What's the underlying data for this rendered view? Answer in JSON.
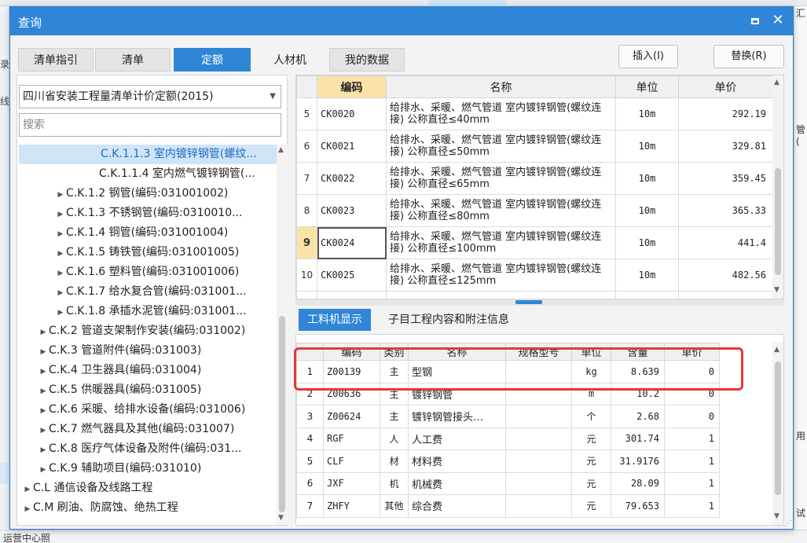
{
  "background": {
    "left_fragments": [
      "录",
      "线"
    ],
    "right_fragments": [
      "汇",
      "管(",
      "用",
      "试"
    ],
    "bottom_fragment": "运营中心照"
  },
  "dialog": {
    "title": "查询",
    "icons": [
      "maximize-icon",
      "close-icon"
    ]
  },
  "tabs": [
    {
      "label": "清单指引",
      "active": false
    },
    {
      "label": "清单",
      "active": false
    },
    {
      "label": "定额",
      "active": true
    },
    {
      "label": "人材机",
      "active": false
    },
    {
      "label": "我的数据",
      "active": false
    }
  ],
  "actions": {
    "insert": "插入(I)",
    "replace": "替换(R)"
  },
  "left": {
    "library": "四川省安装工程量清单计价定额(2015)",
    "search_placeholder": "搜索",
    "tree": [
      {
        "label": "C.K.1.1.3 室内镀锌钢管(螺纹...",
        "level": 3,
        "caret": false,
        "selected": true
      },
      {
        "label": "C.K.1.1.4 室内燃气镀锌钢管(...",
        "level": 3,
        "caret": false,
        "selected": false
      },
      {
        "label": "C.K.1.2 钢管(编码:031001002)",
        "level": 2,
        "caret": true,
        "selected": false
      },
      {
        "label": "C.K.1.3 不锈钢管(编码:0310010...",
        "level": 2,
        "caret": true,
        "selected": false
      },
      {
        "label": "C.K.1.4 铜管(编码:031001004)",
        "level": 2,
        "caret": true,
        "selected": false
      },
      {
        "label": "C.K.1.5 铸铁管(编码:031001005)",
        "level": 2,
        "caret": true,
        "selected": false
      },
      {
        "label": "C.K.1.6 塑料管(编码:031001006)",
        "level": 2,
        "caret": true,
        "selected": false
      },
      {
        "label": "C.K.1.7 给水复合管(编码:031001...",
        "level": 2,
        "caret": true,
        "selected": false
      },
      {
        "label": "C.K.1.8 承插水泥管(编码:031001...",
        "level": 2,
        "caret": true,
        "selected": false
      },
      {
        "label": "C.K.2 管道支架制作安装(编码:031002)",
        "level": 1,
        "caret": true,
        "selected": false
      },
      {
        "label": "C.K.3 管道附件(编码:031003)",
        "level": 1,
        "caret": true,
        "selected": false
      },
      {
        "label": "C.K.4 卫生器具(编码:031004)",
        "level": 1,
        "caret": true,
        "selected": false
      },
      {
        "label": "C.K.5 供暖器具(编码:031005)",
        "level": 1,
        "caret": true,
        "selected": false
      },
      {
        "label": "C.K.6 采暖、给排水设备(编码:031006)",
        "level": 1,
        "caret": true,
        "selected": false
      },
      {
        "label": "C.K.7 燃气器具及其他(编码:031007)",
        "level": 1,
        "caret": true,
        "selected": false
      },
      {
        "label": "C.K.8 医疗气体设备及附件(编码:031...",
        "level": 1,
        "caret": true,
        "selected": false
      },
      {
        "label": "C.K.9 辅助项目(编码:031010)",
        "level": 1,
        "caret": true,
        "selected": false
      },
      {
        "label": "C.L 通信设备及线路工程",
        "level": 0,
        "caret": true,
        "selected": false
      },
      {
        "label": "C.M 刷油、防腐蚀、绝热工程",
        "level": 0,
        "caret": true,
        "selected": false
      }
    ]
  },
  "quota_table": {
    "headers": [
      "",
      "编码",
      "名称",
      "单位",
      "单价"
    ],
    "rows": [
      {
        "no": "5",
        "code": "CK0020",
        "name": "给排水、采暖、燃气管道 室内镀锌钢管(螺纹连接) 公称直径≤40mm",
        "unit": "10m",
        "price": "292.19",
        "current": false
      },
      {
        "no": "6",
        "code": "CK0021",
        "name": "给排水、采暖、燃气管道 室内镀锌钢管(螺纹连接) 公称直径≤50mm",
        "unit": "10m",
        "price": "329.81",
        "current": false
      },
      {
        "no": "7",
        "code": "CK0022",
        "name": "给排水、采暖、燃气管道 室内镀锌钢管(螺纹连接) 公称直径≤65mm",
        "unit": "10m",
        "price": "359.45",
        "current": false
      },
      {
        "no": "8",
        "code": "CK0023",
        "name": "给排水、采暖、燃气管道 室内镀锌钢管(螺纹连接) 公称直径≤80mm",
        "unit": "10m",
        "price": "365.33",
        "current": false
      },
      {
        "no": "9",
        "code": "CK0024",
        "name": "给排水、采暖、燃气管道 室内镀锌钢管(螺纹连接) 公称直径≤100mm",
        "unit": "10m",
        "price": "441.4",
        "current": true
      },
      {
        "no": "10",
        "code": "CK0025",
        "name": "给排水、采暖、燃气管道 室内镀锌钢管(螺纹连接) 公称直径≤125mm",
        "unit": "10m",
        "price": "482.56",
        "current": false
      },
      {
        "no": "",
        "code": "",
        "name": "给排水、采暖、燃气管道 室内镀锌钢管(螺",
        "unit": "",
        "price": "",
        "current": false
      }
    ]
  },
  "bottom_tabs": [
    {
      "label": "工料机显示",
      "active": true
    },
    {
      "label": "子目工程内容和附注信息",
      "active": false
    }
  ],
  "material_table": {
    "headers": [
      "",
      "编码",
      "类别",
      "名称",
      "规格型号",
      "单位",
      "含量",
      "单价"
    ],
    "rows": [
      {
        "no": "1",
        "code": "Z00139",
        "type": "主",
        "name": "型钢",
        "spec": "",
        "unit": "kg",
        "amount": "8.639",
        "price": "0"
      },
      {
        "no": "2",
        "code": "Z00636",
        "type": "主",
        "name": "镀锌钢管",
        "spec": "",
        "unit": "m",
        "amount": "10.2",
        "price": "0"
      },
      {
        "no": "3",
        "code": "Z00624",
        "type": "主",
        "name": "镀锌钢管接头…",
        "spec": "",
        "unit": "个",
        "amount": "2.68",
        "price": "0"
      },
      {
        "no": "4",
        "code": "RGF",
        "type": "人",
        "name": "人工费",
        "spec": "",
        "unit": "元",
        "amount": "301.74",
        "price": "1"
      },
      {
        "no": "5",
        "code": "CLF",
        "type": "材",
        "name": "材料费",
        "spec": "",
        "unit": "元",
        "amount": "31.9176",
        "price": "1"
      },
      {
        "no": "6",
        "code": "JXF",
        "type": "机",
        "name": "机械费",
        "spec": "",
        "unit": "元",
        "amount": "28.09",
        "price": "1"
      },
      {
        "no": "7",
        "code": "ZHFY",
        "type": "其他",
        "name": "综合费",
        "spec": "",
        "unit": "元",
        "amount": "79.653",
        "price": "1"
      }
    ]
  },
  "colors": {
    "accent": "#2f86d6",
    "highlight": "#fbe3a7",
    "annotation": "#e53935"
  }
}
